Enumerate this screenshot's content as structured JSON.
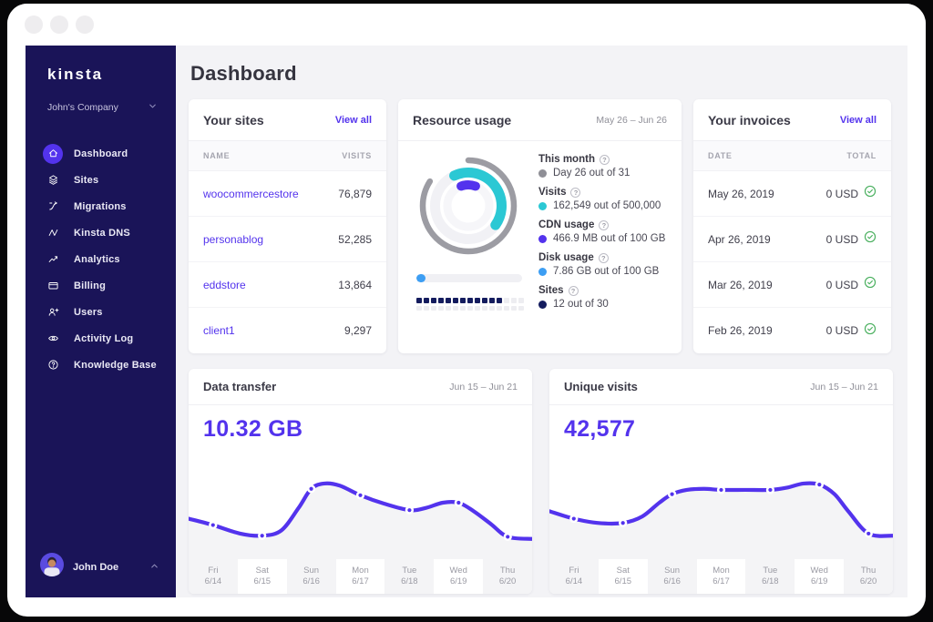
{
  "window": {
    "controls": [
      "dot",
      "dot",
      "dot"
    ]
  },
  "sidebar": {
    "logo_text": "Kinsta",
    "company": {
      "name": "John's Company"
    },
    "items": [
      {
        "label": "Dashboard",
        "icon": "home",
        "active": true
      },
      {
        "label": "Sites",
        "icon": "sites"
      },
      {
        "label": "Migrations",
        "icon": "migrations"
      },
      {
        "label": "Kinsta DNS",
        "icon": "dns"
      },
      {
        "label": "Analytics",
        "icon": "analytics"
      },
      {
        "label": "Billing",
        "icon": "billing"
      },
      {
        "label": "Users",
        "icon": "users"
      },
      {
        "label": "Activity Log",
        "icon": "activity"
      },
      {
        "label": "Knowledge Base",
        "icon": "knowledge"
      }
    ],
    "user": {
      "name": "John Doe"
    }
  },
  "header": {
    "title": "Dashboard"
  },
  "sites_card": {
    "title": "Your sites",
    "view_all": "View all",
    "columns": [
      "NAME",
      "VISITS"
    ],
    "rows": [
      {
        "name": "woocommercestore",
        "visits": "76,879"
      },
      {
        "name": "personablog",
        "visits": "52,285"
      },
      {
        "name": "eddstore",
        "visits": "13,864"
      },
      {
        "name": "client1",
        "visits": "9,297"
      }
    ]
  },
  "resource_card": {
    "title": "Resource usage",
    "period": "May 26 – Jun 26",
    "donut": {
      "month_pct": 83.9,
      "visits_sweep_deg": 150,
      "cdn_sweep_deg": 40,
      "colors": {
        "month": "#9C9CA3",
        "visits": "#2BC8D4",
        "cdn": "#5333ED",
        "track": "#F1F1F5"
      }
    },
    "legend": [
      {
        "label": "This month",
        "value": "Day 26 out of 31",
        "color": "#8F8F96"
      },
      {
        "label": "Visits",
        "value": "162,549 out of 500,000",
        "color": "#2BC8D4"
      },
      {
        "label": "CDN usage",
        "value": "466.9 MB out of 100 GB",
        "color": "#5333ED"
      },
      {
        "label": "Disk usage",
        "value": "7.86 GB out of 100 GB",
        "color": "#3D9EF3"
      },
      {
        "label": "Sites",
        "value": "12 out of 30",
        "color": "#141C5E"
      }
    ],
    "disk_bar": {
      "pct": 9,
      "color": "#3D9EF3"
    },
    "sites_grid": {
      "filled": 12,
      "total": 30,
      "per_row": 15,
      "fill_color": "#141C5E",
      "empty_color": "#EDEDF1"
    }
  },
  "invoices_card": {
    "title": "Your invoices",
    "view_all": "View all",
    "columns": [
      "DATE",
      "TOTAL"
    ],
    "rows": [
      {
        "date": "May 26, 2019",
        "total": "0 USD",
        "status": "paid"
      },
      {
        "date": "Apr 26, 2019",
        "total": "0 USD",
        "status": "paid"
      },
      {
        "date": "Mar 26, 2019",
        "total": "0 USD",
        "status": "paid"
      },
      {
        "date": "Feb 26, 2019",
        "total": "0 USD",
        "status": "paid"
      }
    ],
    "paid_color": "#49AF5E"
  },
  "chart_data": [
    {
      "type": "area",
      "title": "Data transfer",
      "period": "Jun 15 – Jun 21",
      "total": "10.32 GB",
      "line_color": "#5333ED",
      "fill_color": "#F4F4F6",
      "x_labels": [
        [
          "Fri",
          "6/14"
        ],
        [
          "Sat",
          "6/15"
        ],
        [
          "Sun",
          "6/16"
        ],
        [
          "Mon",
          "6/17"
        ],
        [
          "Tue",
          "6/18"
        ],
        [
          "Wed",
          "6/19"
        ],
        [
          "Thu",
          "6/20"
        ]
      ],
      "points": [
        [
          0,
          62
        ],
        [
          7.1,
          68
        ],
        [
          15,
          76
        ],
        [
          21.4,
          78
        ],
        [
          27,
          73
        ],
        [
          32,
          52
        ],
        [
          35.7,
          34
        ],
        [
          39.5,
          29
        ],
        [
          44,
          31
        ],
        [
          50,
          40
        ],
        [
          57,
          48
        ],
        [
          64.3,
          54
        ],
        [
          69,
          52
        ],
        [
          74,
          47
        ],
        [
          78.6,
          47
        ],
        [
          83,
          55
        ],
        [
          88,
          67
        ],
        [
          92.9,
          79
        ],
        [
          100,
          81
        ]
      ],
      "markers": [
        [
          7.1,
          68
        ],
        [
          21.4,
          78
        ],
        [
          35.7,
          34
        ],
        [
          50,
          40
        ],
        [
          64.3,
          54
        ],
        [
          78.6,
          47
        ],
        [
          92.9,
          79
        ]
      ]
    },
    {
      "type": "area",
      "title": "Unique visits",
      "period": "Jun 15 – Jun 21",
      "total": "42,577",
      "line_color": "#5333ED",
      "fill_color": "#F4F4F6",
      "x_labels": [
        [
          "Fri",
          "6/14"
        ],
        [
          "Sat",
          "6/15"
        ],
        [
          "Sun",
          "6/16"
        ],
        [
          "Mon",
          "6/17"
        ],
        [
          "Tue",
          "6/18"
        ],
        [
          "Wed",
          "6/19"
        ],
        [
          "Thu",
          "6/20"
        ]
      ],
      "points": [
        [
          0,
          55
        ],
        [
          7.1,
          62
        ],
        [
          14,
          66
        ],
        [
          21.4,
          66
        ],
        [
          27,
          60
        ],
        [
          32,
          47
        ],
        [
          35.7,
          39
        ],
        [
          40,
          35
        ],
        [
          45,
          34
        ],
        [
          50,
          35
        ],
        [
          57,
          35
        ],
        [
          64.3,
          35
        ],
        [
          69,
          33
        ],
        [
          74,
          29
        ],
        [
          78.6,
          30
        ],
        [
          83,
          39
        ],
        [
          87,
          55
        ],
        [
          92.9,
          76
        ],
        [
          100,
          78
        ]
      ],
      "markers": [
        [
          7.1,
          62
        ],
        [
          21.4,
          66
        ],
        [
          35.7,
          39
        ],
        [
          50,
          35
        ],
        [
          64.3,
          35
        ],
        [
          78.6,
          30
        ],
        [
          92.9,
          76
        ]
      ]
    }
  ]
}
